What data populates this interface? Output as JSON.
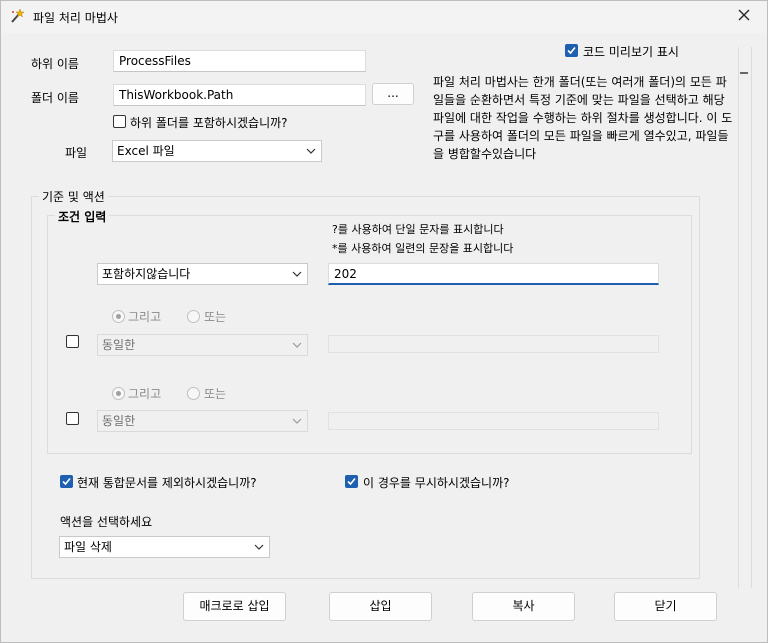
{
  "window": {
    "title": "파일 처리 마법사"
  },
  "fields": {
    "sub_name_label": "하위 이름",
    "sub_name_value": "ProcessFiles",
    "folder_name_label": "폴더 이름",
    "folder_name_value": "ThisWorkbook.Path",
    "browse_label": "...",
    "include_subfolders_label": "하위 폴더를 포함하시겠습니까?",
    "file_label": "파일",
    "file_type_value": "Excel 파일"
  },
  "preview": {
    "checkbox_label": "코드 미리보기 표시",
    "description": "파일 처리 마법사는 한개 폴더(또는 여러개 폴더)의 모든 파일들을 순환하면서 특정 기준에 맞는 파일을 선택하고 해당 파일에 대한 작업을 수행하는 하위 절차를 생성합니다. 이 도구를 사용하여 폴더의 모든 파일을 빠르게 열수있고, 파일들을 병합할수있습니다"
  },
  "criteria": {
    "group_label": "기준 및 액션",
    "condition_label": "조건 입력",
    "hint1": "?를 사용하여 단일 문자를 표시합니다",
    "hint2": "*를 사용하여 일련의 문장을 표시합니다",
    "row1_operator": "포함하지않습니다",
    "row1_value": "202",
    "and_label": "그리고",
    "or_label": "또는",
    "row2_operator": "동일한",
    "row3_operator": "동일한"
  },
  "options": {
    "exclude_current_label": "현재 통합문서를 제외하시겠습니까?",
    "ignore_case_label": "이 경우를 무시하시겠습니까?",
    "action_label": "액션을 선택하세요",
    "action_value": "파일 삭제"
  },
  "buttons": {
    "insert_macro": "매크로로 삽입",
    "insert": "삽입",
    "copy": "복사",
    "close": "닫기"
  },
  "colors": {
    "accent": "#1f5fb0"
  }
}
